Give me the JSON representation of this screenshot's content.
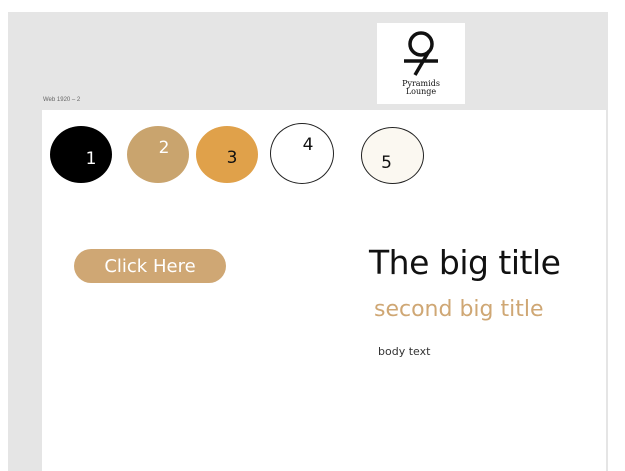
{
  "frame": {
    "label": "Web 1920 – 2"
  },
  "logo": {
    "line1": "Pyramids",
    "line2": "Lounge",
    "icon": "pyramids-lounge-logo-icon"
  },
  "circles": [
    {
      "label": "1",
      "color": "#000000"
    },
    {
      "label": "2",
      "color": "#c9a46e"
    },
    {
      "label": "3",
      "color": "#e0a14a"
    },
    {
      "label": "4",
      "color": "#ffffff"
    },
    {
      "label": "5",
      "color": "#fbf8f1"
    }
  ],
  "cta": {
    "label": "Click Here",
    "color": "#cfa774"
  },
  "content": {
    "title": "The big title",
    "subtitle": "second big title",
    "body": "body text",
    "accent_color": "#cfa774"
  }
}
